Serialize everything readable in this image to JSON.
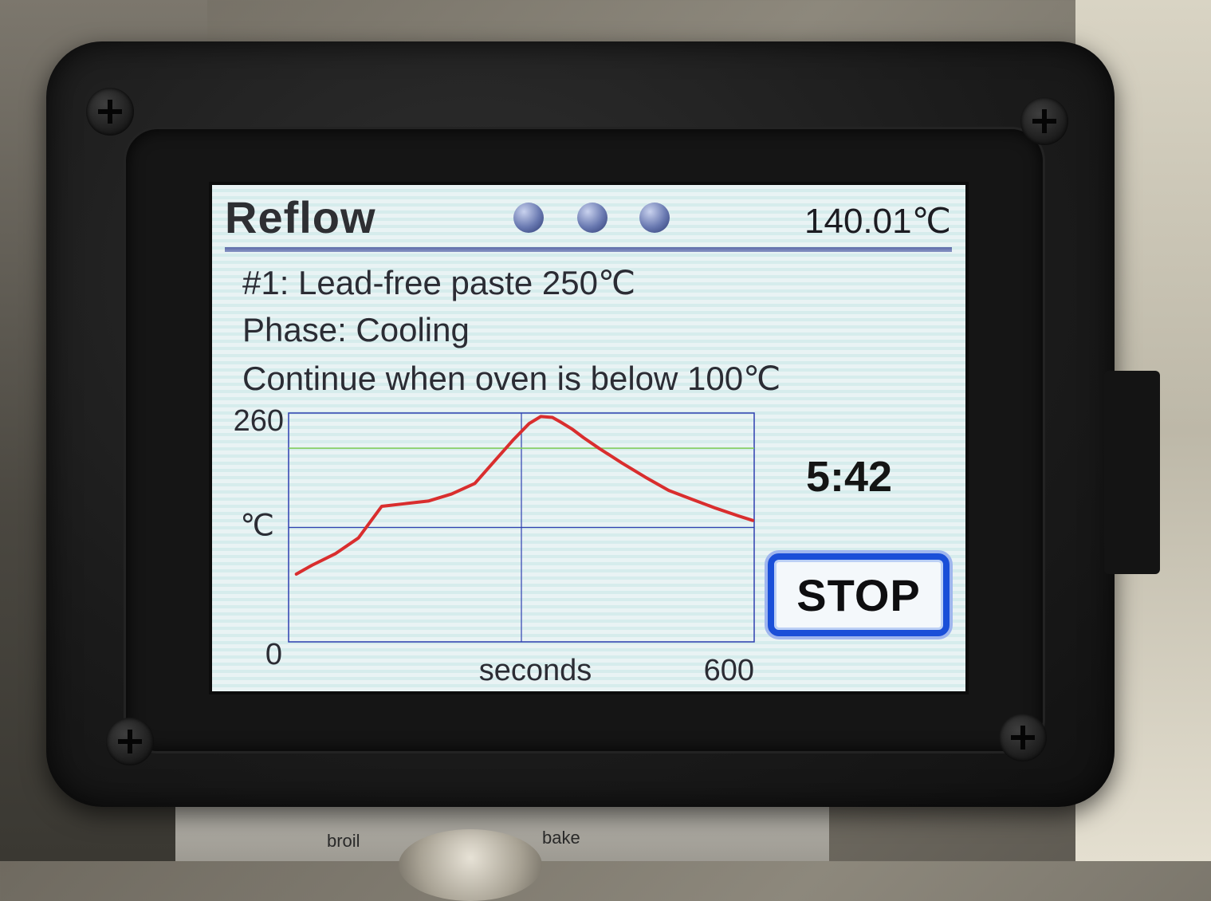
{
  "screen": {
    "title": "Reflow",
    "status_dots": 3,
    "current_temperature": "140.01℃",
    "profile_line": "#1: Lead-free paste 250℃",
    "phase_line": "Phase: Cooling",
    "instruction_line": "Continue when oven is below 100℃",
    "timer": "5:42",
    "stop_label": "STOP"
  },
  "colors": {
    "curve": "#d92e2e",
    "target_line": "#7fcc55",
    "grid": "#2f3fb0",
    "button_border": "#1a4fd8",
    "title_rule": "#5b6aa8"
  },
  "oven_labels": {
    "left": "broil",
    "right": "bake"
  },
  "chart_data": {
    "type": "line",
    "title": "",
    "xlabel": "seconds",
    "ylabel": "℃",
    "xlim": [
      0,
      600
    ],
    "ylim": [
      0,
      260
    ],
    "x_tick_labels": [
      "600"
    ],
    "y_tick_labels": [
      "260",
      "0"
    ],
    "reference_line": 220,
    "series": [
      {
        "x": [
          10,
          30,
          60,
          90,
          120,
          150,
          180,
          210,
          240,
          265,
          290,
          310,
          325,
          340,
          350,
          365,
          380,
          400,
          430,
          460,
          490,
          520,
          550,
          580,
          598
        ],
        "y": [
          77,
          87,
          100,
          118,
          154,
          157,
          160,
          168,
          180,
          205,
          230,
          248,
          256,
          255,
          250,
          242,
          232,
          220,
          203,
          187,
          172,
          162,
          152,
          143,
          138
        ]
      }
    ]
  }
}
